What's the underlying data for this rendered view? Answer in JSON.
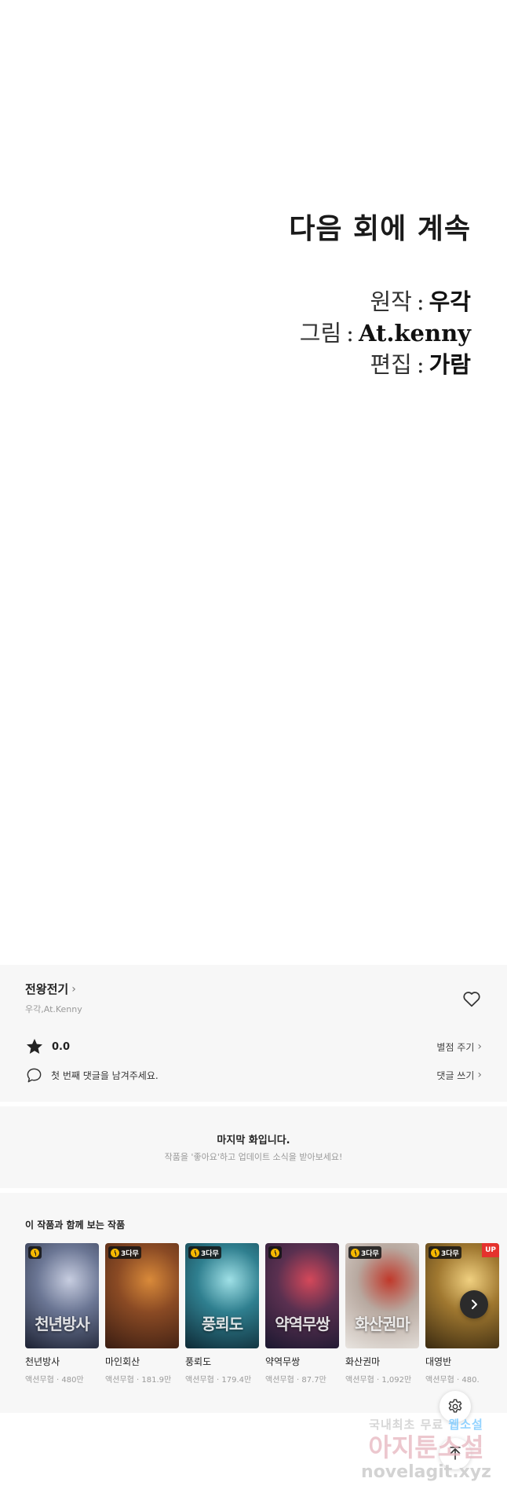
{
  "comic": {
    "to_be_continued": "다음 회에 계속",
    "credits": [
      {
        "key": "원작",
        "sep": ":",
        "value": "우각"
      },
      {
        "key": "그림",
        "sep": ":",
        "value": "At.kenny"
      },
      {
        "key": "편집",
        "sep": ":",
        "value": "가람"
      }
    ]
  },
  "info": {
    "title": "전왕전기",
    "authors": "우각,At.Kenny",
    "rating": "0.0",
    "rate_link": "별점 주기",
    "comment_prompt": "첫 번째 댓글을 남겨주세요.",
    "comment_link": "댓글 쓰기"
  },
  "notice": {
    "headline": "마지막 화입니다.",
    "sub": "작품을 '좋아요'하고 업데이트 소식을 받아보세요!"
  },
  "recommendations": {
    "title": "이 작품과 함께 보는 작품",
    "items": [
      {
        "name": "천년방사",
        "genre": "액션무협",
        "views": "480만",
        "badge": "",
        "up": false,
        "cover_text": "천년방사",
        "colors": [
          "#1d2233",
          "#6b7694",
          "#c7cde0"
        ]
      },
      {
        "name": "마인회산",
        "genre": "액션무협",
        "views": "181.9만",
        "badge": "3다무",
        "up": false,
        "cover_text": "",
        "colors": [
          "#3a1d12",
          "#8a4a24",
          "#d98a3a"
        ]
      },
      {
        "name": "풍뢰도",
        "genre": "액션무협",
        "views": "179.4만",
        "badge": "3다무",
        "up": false,
        "cover_text": "풍뢰도",
        "colors": [
          "#0e2a36",
          "#2f7f8f",
          "#9fe0e6"
        ]
      },
      {
        "name": "약역무쌍",
        "genre": "액션무협",
        "views": "87.7만",
        "badge": "",
        "up": false,
        "cover_text": "약역무쌍",
        "colors": [
          "#1b1830",
          "#5a3050",
          "#d4485a"
        ]
      },
      {
        "name": "화산권마",
        "genre": "액션무협",
        "views": "1,092만",
        "badge": "3다무",
        "up": false,
        "cover_text": "화산권마",
        "colors": [
          "#e8e4df",
          "#b8a9a0",
          "#c0392b"
        ]
      },
      {
        "name": "대영반",
        "genre": "액션무협",
        "views": "480.",
        "badge": "3다무",
        "up": true,
        "cover_text": "",
        "colors": [
          "#3a2a10",
          "#a07830",
          "#f0d080"
        ]
      }
    ],
    "separator": "·"
  },
  "watermark": {
    "line1_a": "국내최초 무료",
    "line1_b": "웹소설",
    "line2": "아지툰소설",
    "line3": "novelagit.xyz"
  },
  "icons": {
    "title_chevron": "chevron-right-icon",
    "heart": "heart-outline-icon",
    "star": "star-filled-icon",
    "comment": "comment-bubble-icon",
    "next": "chevron-right-icon",
    "settings": "gear-icon",
    "top": "arrow-up-icon"
  }
}
